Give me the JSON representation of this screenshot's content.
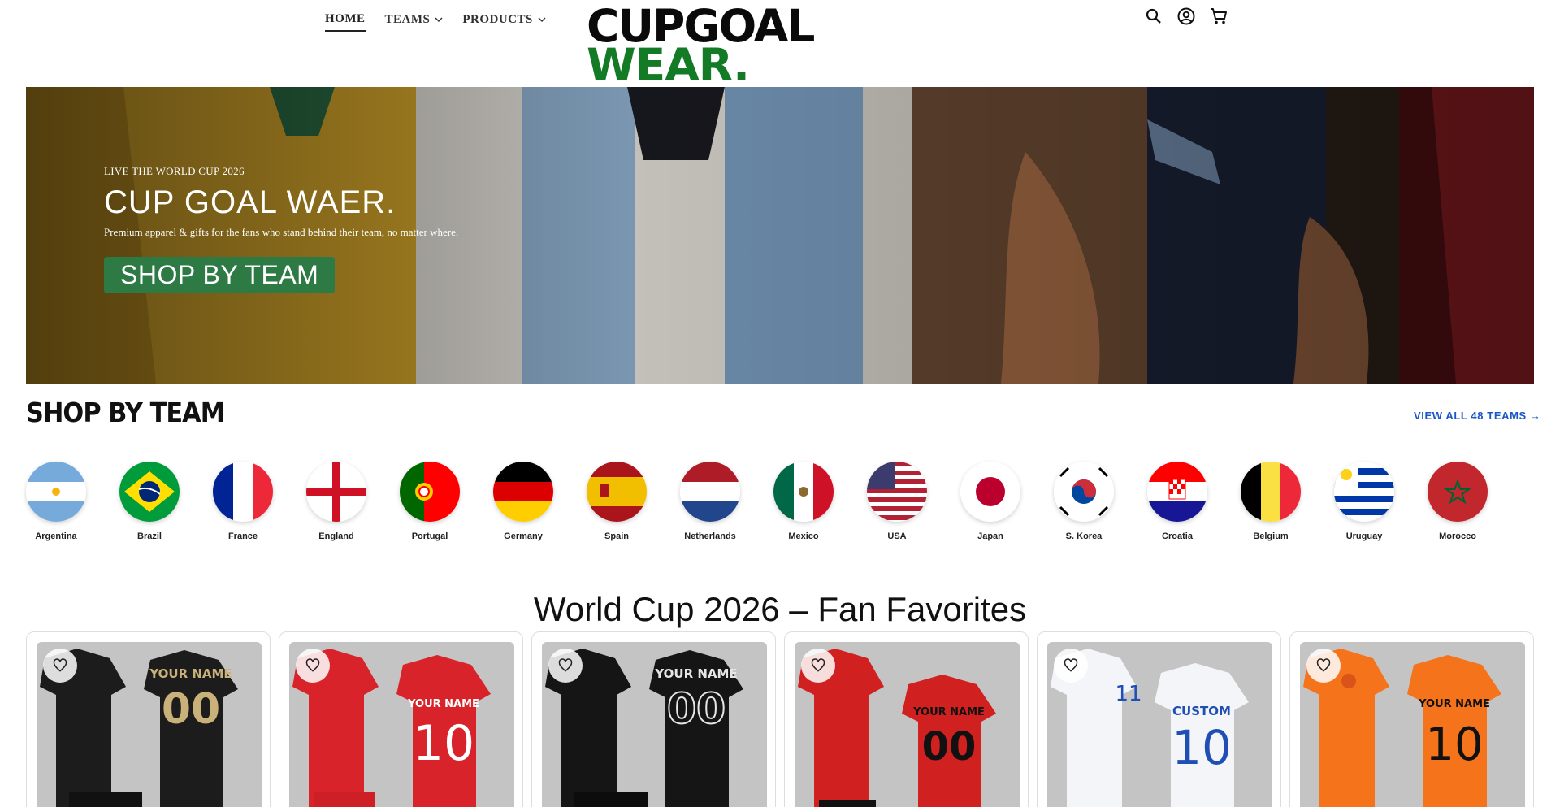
{
  "nav": {
    "items": [
      {
        "label": "HOME",
        "active": true,
        "dropdown": false
      },
      {
        "label": "TEAMS",
        "active": false,
        "dropdown": true
      },
      {
        "label": "PRODUCTS",
        "active": false,
        "dropdown": true
      }
    ]
  },
  "logo": {
    "line1": "CUPGOAL",
    "line2": "WEAR."
  },
  "header_icons": [
    "search-icon",
    "account-icon",
    "cart-icon"
  ],
  "hero": {
    "kicker": "LIVE THE WORLD CUP 2026",
    "title": "CUP GOAL WAER.",
    "subtitle": "Premium apparel & gifts for the fans who stand behind their team, no matter where.",
    "button": "SHOP BY TEAM"
  },
  "shop_by_team": {
    "title": "SHOP BY TEAM",
    "view_all": "VIEW ALL 48 TEAMS →",
    "teams": [
      {
        "name": "Argentina"
      },
      {
        "name": "Brazil"
      },
      {
        "name": "France"
      },
      {
        "name": "England"
      },
      {
        "name": "Portugal"
      },
      {
        "name": "Germany"
      },
      {
        "name": "Spain"
      },
      {
        "name": "Netherlands"
      },
      {
        "name": "Mexico"
      },
      {
        "name": "USA"
      },
      {
        "name": "Japan"
      },
      {
        "name": "S. Korea"
      },
      {
        "name": "Croatia"
      },
      {
        "name": "Belgium"
      },
      {
        "name": "Uruguay"
      },
      {
        "name": "Morocco"
      }
    ]
  },
  "favorites": {
    "title": "World Cup 2026 – Fan Favorites",
    "products": [
      {
        "shirt_text": "YOUR NAME",
        "number": "00",
        "shirt_color": "#1c1c1c",
        "text_color": "#c9b27a"
      },
      {
        "shirt_text": "YOUR NAME",
        "number": "10",
        "shirt_color": "#d8232a",
        "text_color": "#ffffff"
      },
      {
        "shirt_text": "YOUR NAME",
        "number": "00",
        "shirt_color": "#151515",
        "text_color": "#e6e6e6"
      },
      {
        "shirt_text": "YOUR NAME",
        "number": "00",
        "shirt_color": "#d0201f",
        "text_color": "#111111"
      },
      {
        "shirt_text": "CUSTOM",
        "number": "10",
        "shirt_color": "#f4f5f9",
        "text_color": "#1f4fb5"
      },
      {
        "shirt_text": "YOUR NAME",
        "number": "10",
        "shirt_color": "#f5731a",
        "text_color": "#111111"
      }
    ]
  }
}
